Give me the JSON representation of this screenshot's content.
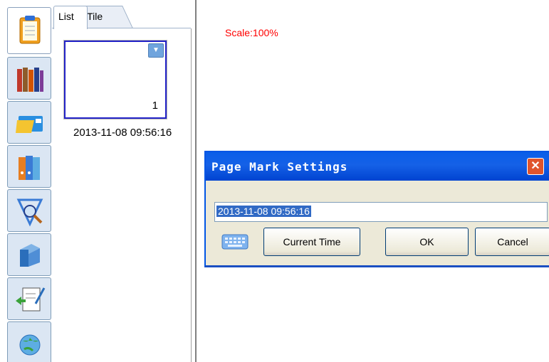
{
  "toolbar": {
    "items": [
      {
        "name": "clipboard-icon"
      },
      {
        "name": "books-icon"
      },
      {
        "name": "folder-icon"
      },
      {
        "name": "binders-icon"
      },
      {
        "name": "search-icon"
      },
      {
        "name": "file-cabinet-icon"
      },
      {
        "name": "edit-document-icon"
      },
      {
        "name": "globe-icon"
      }
    ]
  },
  "panel": {
    "tabs": {
      "list": "List",
      "tile": "Tile"
    },
    "thumbnail": {
      "page_number": "1",
      "date": "2013-11-08 09:56:16",
      "dropdown": "▼"
    }
  },
  "scale": "Scale:100%",
  "dialog": {
    "title": "Page Mark Settings",
    "close": "✕",
    "input_value": "2013-11-08 09:56:16",
    "buttons": {
      "current_time": "Current Time",
      "ok": "OK",
      "cancel": "Cancel"
    }
  },
  "colors": {
    "title_bar": "#0a5ee8",
    "scale_text": "#ff0000",
    "thumbnail_border": "#2323c8",
    "selection": "#316ac5"
  }
}
